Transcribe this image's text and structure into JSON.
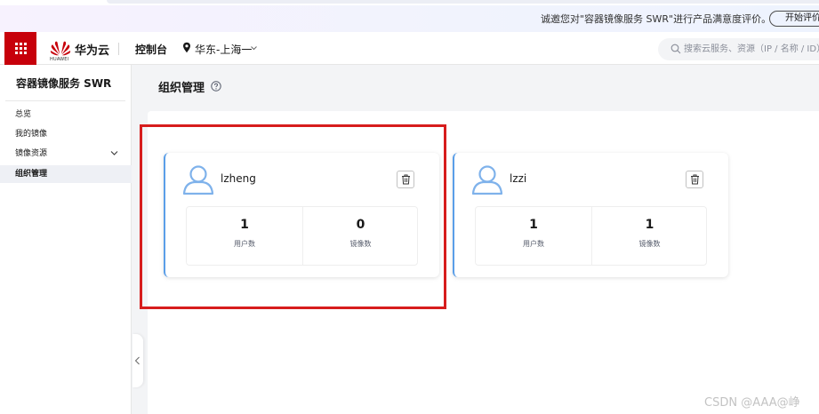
{
  "notice": {
    "text": "诚邀您对\"容器镜像服务 SWR\"进行产品满意度评价。",
    "button": "开始评价"
  },
  "header": {
    "logo_text": "HUAWEI",
    "brand": "华为云",
    "console": "控制台",
    "region": "华东-上海一",
    "search_placeholder": "搜索云服务、资源（IP / 名称 / ID）"
  },
  "sidebar": {
    "title": "容器镜像服务 SWR",
    "items": [
      {
        "label": "总览"
      },
      {
        "label": "我的镜像"
      },
      {
        "label": "镜像资源"
      },
      {
        "label": "组织管理"
      }
    ]
  },
  "main": {
    "title": "组织管理",
    "organizations": [
      {
        "name": "lzheng",
        "user_count": "1",
        "user_label": "用户数",
        "image_count": "0",
        "image_label": "镜像数"
      },
      {
        "name": "lzzi",
        "user_count": "1",
        "user_label": "用户数",
        "image_count": "1",
        "image_label": "镜像数"
      }
    ]
  },
  "watermark": "CSDN @AAA@峥",
  "colors": {
    "brand_red": "#c7000b",
    "highlight": "#d71d1d",
    "card_accent": "#5a9ee8",
    "avatar_blue": "#7fb2eb"
  },
  "icons": [
    "grid-icon",
    "huawei-logo-icon",
    "location-pin-icon",
    "chevron-down-icon",
    "search-icon",
    "help-icon",
    "user-avatar-icon",
    "trash-icon",
    "chevron-left-icon"
  ]
}
